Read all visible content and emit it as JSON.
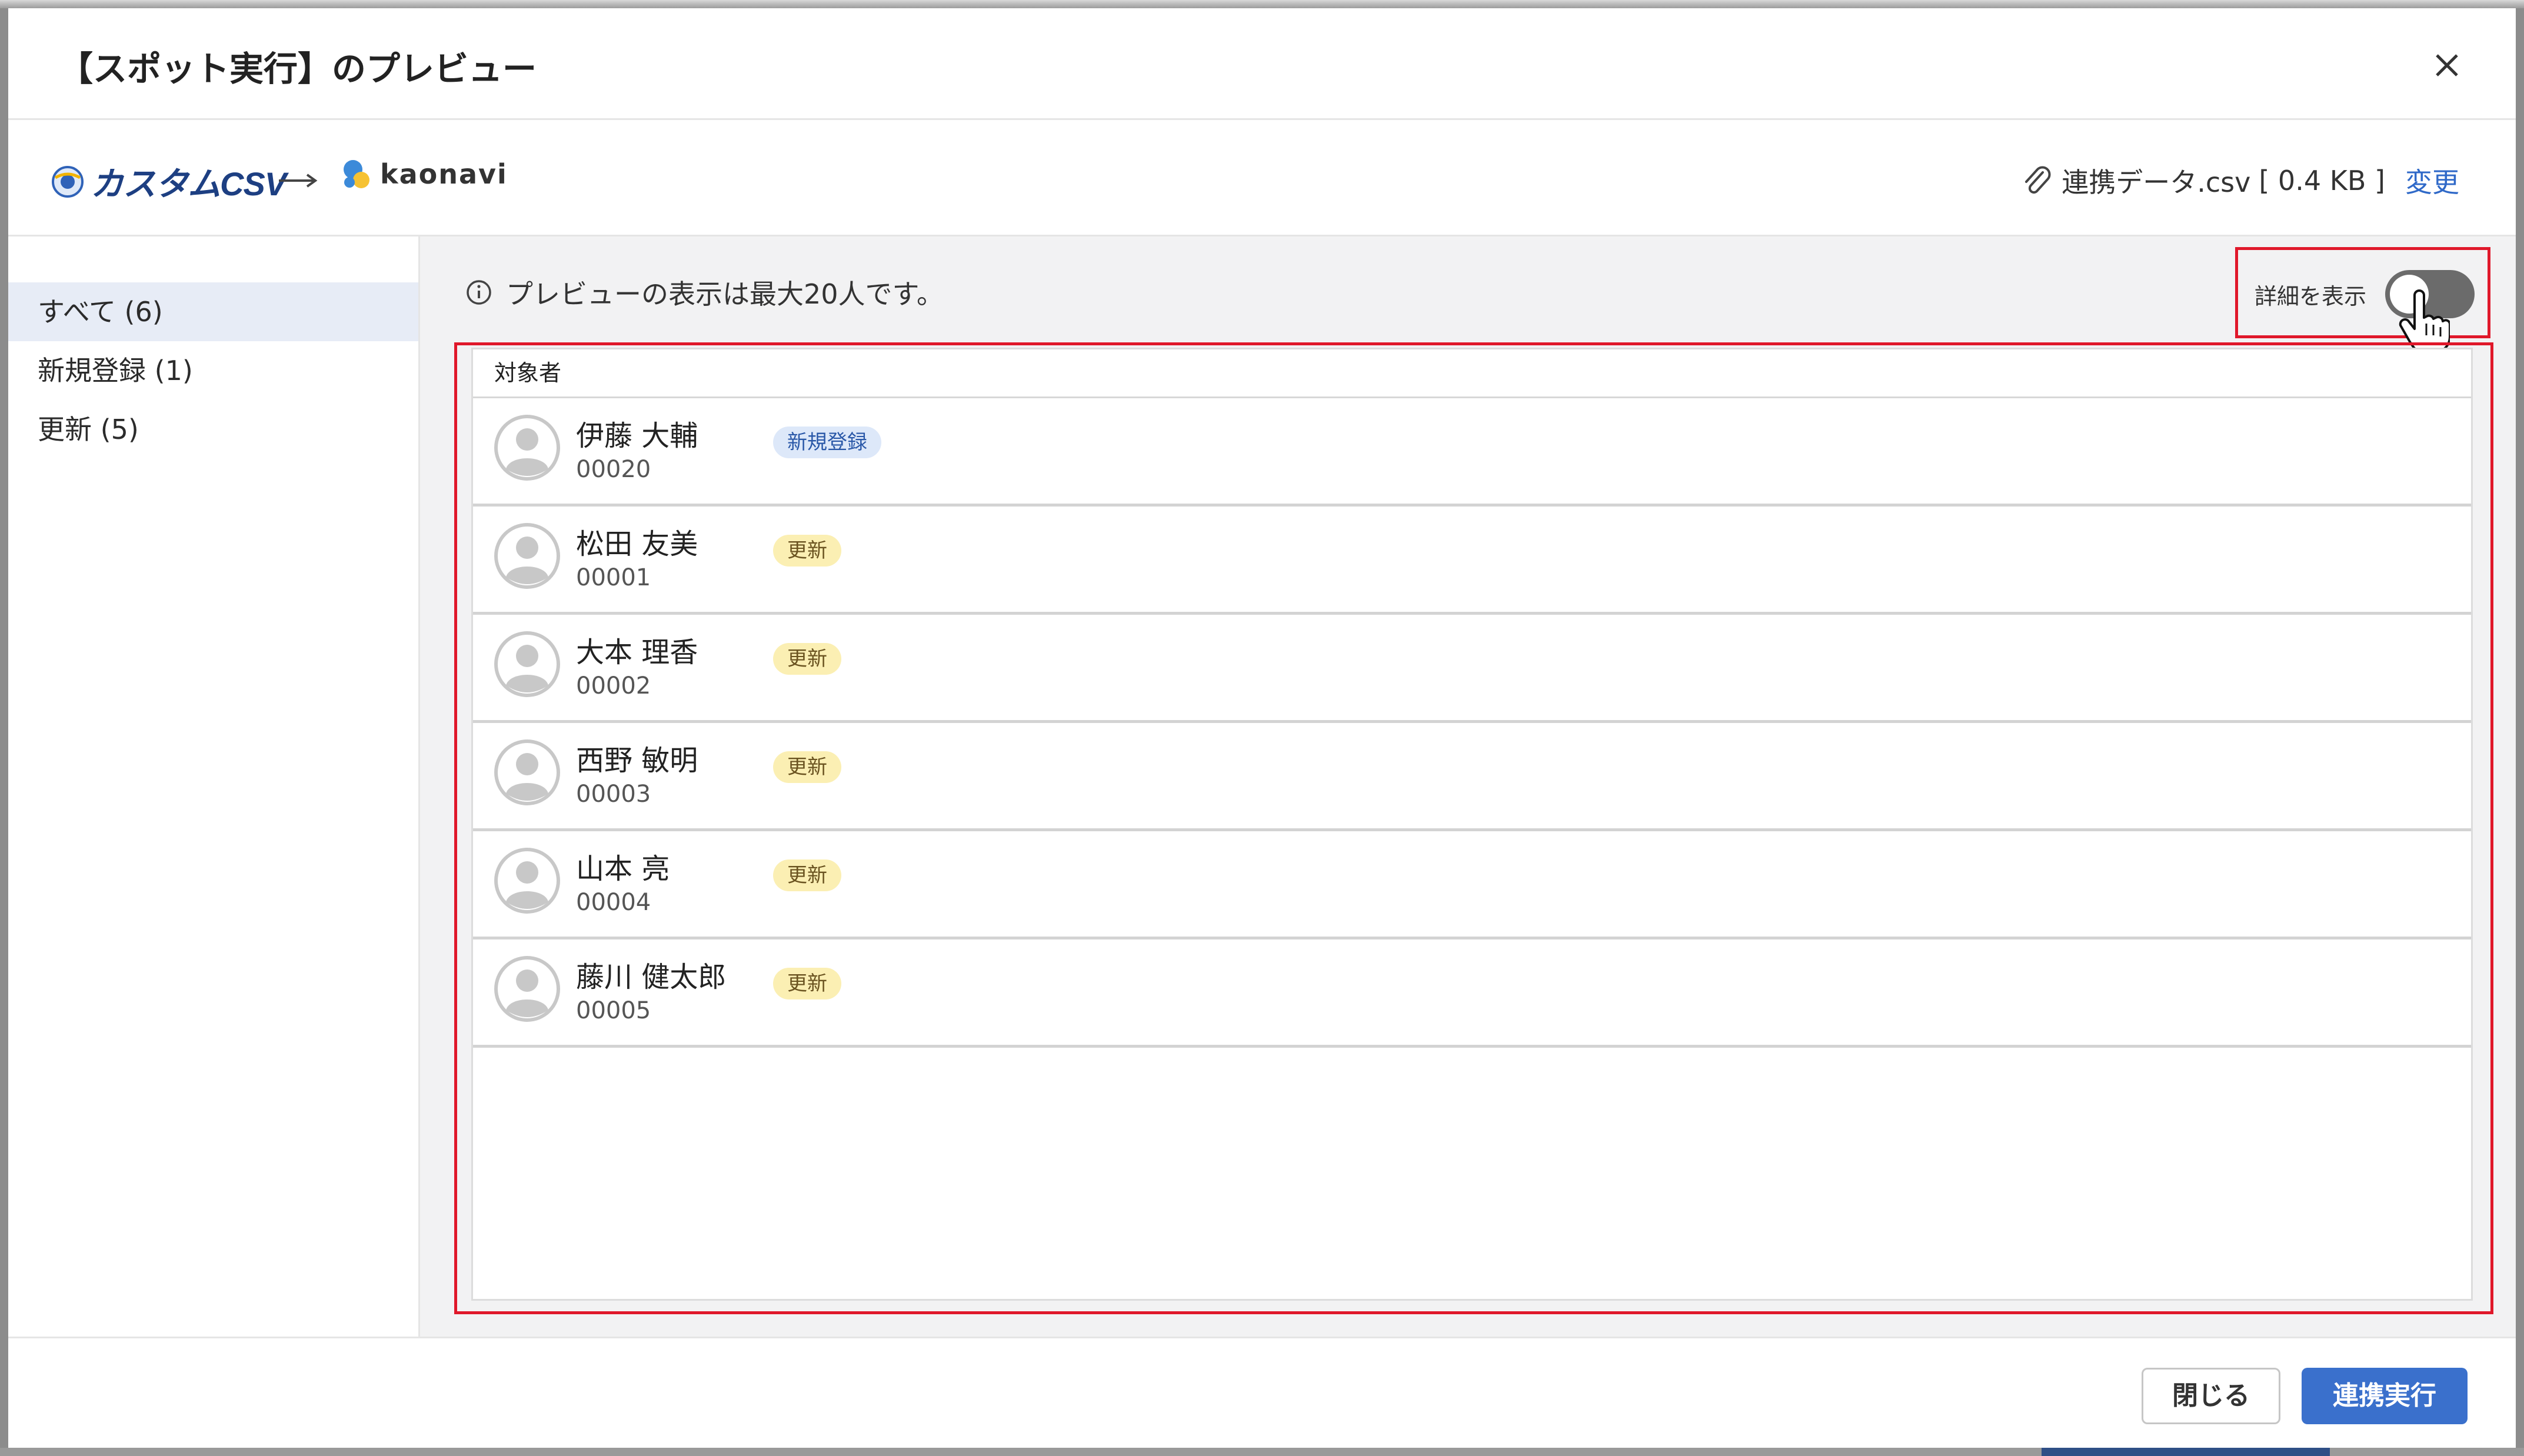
{
  "modal": {
    "title": "【スポット実行】のプレビュー"
  },
  "flow": {
    "source": "カスタムCSV",
    "destination": "kaonavi"
  },
  "file": {
    "name": "連携データ.csv",
    "size": "[ 0.4 KB ]",
    "change_label": "変更"
  },
  "sidebar": {
    "items": [
      {
        "label": "すべて (6)",
        "active": true
      },
      {
        "label": "新規登録 (1)",
        "active": false
      },
      {
        "label": "更新 (5)",
        "active": false
      }
    ]
  },
  "notice": "プレビューの表示は最大20人です。",
  "toggle": {
    "label": "詳細を表示",
    "state": "off"
  },
  "table": {
    "header": "対象者",
    "rows": [
      {
        "name": "伊藤 大輔",
        "code": "00020",
        "badge": "新規登録",
        "badge_type": "new"
      },
      {
        "name": "松田 友美",
        "code": "00001",
        "badge": "更新",
        "badge_type": "update"
      },
      {
        "name": "大本 理香",
        "code": "00002",
        "badge": "更新",
        "badge_type": "update"
      },
      {
        "name": "西野 敏明",
        "code": "00003",
        "badge": "更新",
        "badge_type": "update"
      },
      {
        "name": "山本 亮",
        "code": "00004",
        "badge": "更新",
        "badge_type": "update"
      },
      {
        "name": "藤川 健太郎",
        "code": "00005",
        "badge": "更新",
        "badge_type": "update"
      }
    ]
  },
  "footer": {
    "close_label": "閉じる",
    "run_label": "連携実行"
  },
  "colors": {
    "accent": "#3a70cc",
    "highlight_border": "#e0182a",
    "badge_new_bg": "#dde8f9",
    "badge_update_bg": "#fbefb3"
  },
  "icons": [
    "close-icon",
    "csv-globe-icon",
    "arrow-right-icon",
    "kaonavi-logo-icon",
    "paperclip-icon",
    "info-icon",
    "avatar-icon",
    "hand-cursor-icon"
  ]
}
